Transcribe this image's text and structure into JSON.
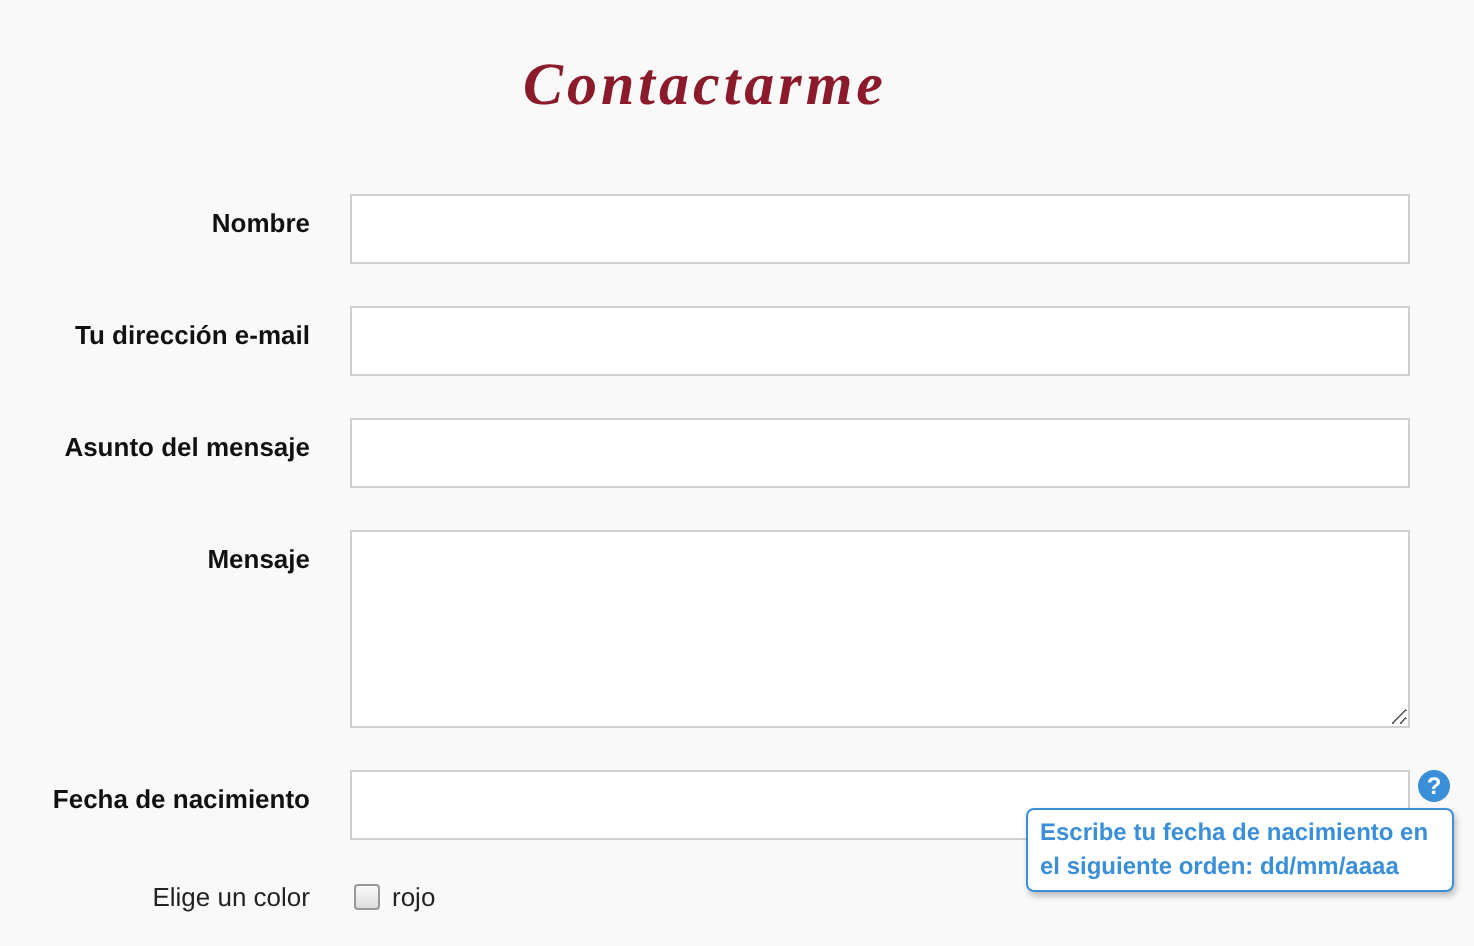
{
  "title": "Contactarme",
  "fields": [
    {
      "kind": "text",
      "label": "Nombre"
    },
    {
      "kind": "text",
      "label": "Tu dirección e-mail"
    },
    {
      "kind": "text",
      "label": "Asunto del mensaje"
    },
    {
      "kind": "textarea",
      "label": "Mensaje"
    },
    {
      "kind": "date",
      "label": "Fecha de nacimiento",
      "help": {
        "icon": "?",
        "tooltip": "Escribe tu fecha de nacimiento en el siguiente orden: dd/mm/aaaa"
      }
    },
    {
      "kind": "checkbox",
      "label": "Elige un color",
      "option": "rojo",
      "checked": false
    }
  ]
}
